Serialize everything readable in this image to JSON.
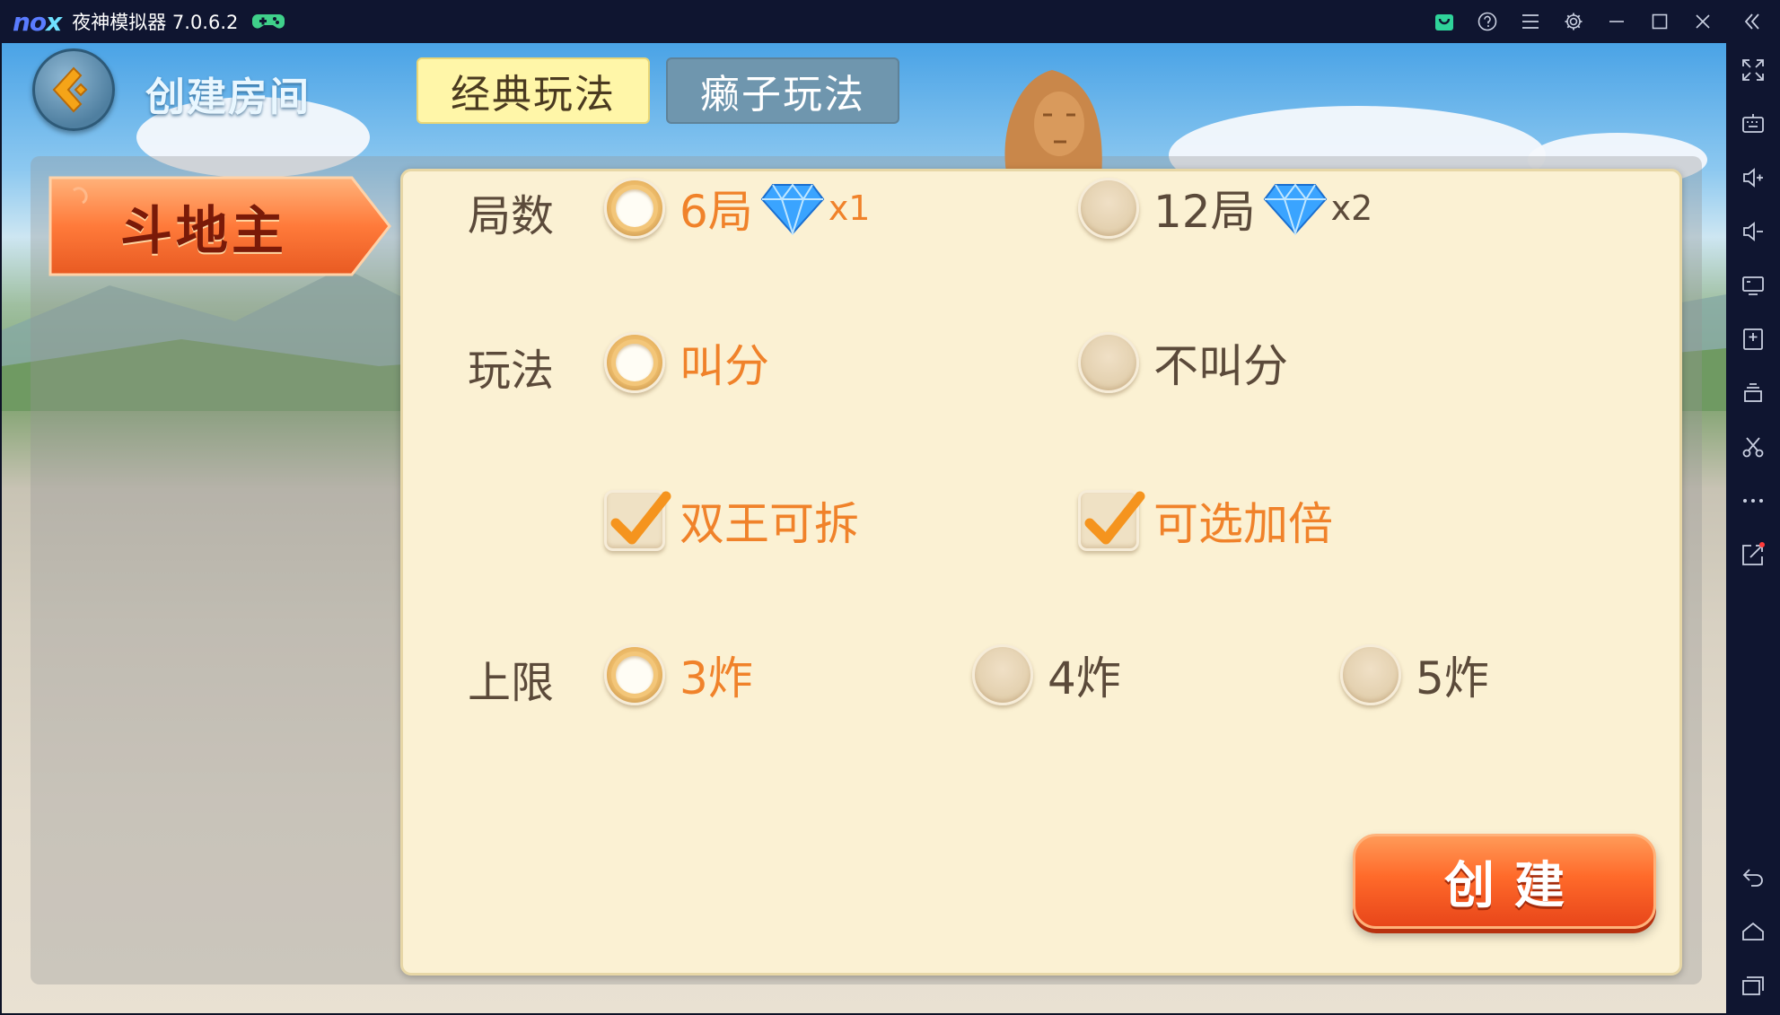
{
  "emulator": {
    "title": "夜神模拟器 7.0.6.2",
    "logo_text": "nox",
    "titlebar_icons": [
      "store-icon",
      "help-icon",
      "menu-icon",
      "settings-icon",
      "minimize-icon",
      "maximize-icon",
      "close-icon",
      "collapse-sidebar-icon"
    ],
    "sidebar_icons": [
      "fullscreen-icon",
      "keyboard-icon",
      "volume-up-icon",
      "volume-down-icon",
      "screen-icon",
      "apk-install-icon",
      "multi-instance-icon",
      "screenshot-icon",
      "more-icon",
      "share-icon",
      "back-icon",
      "home-icon",
      "recent-apps-icon"
    ]
  },
  "game": {
    "page_title": "创建房间",
    "tabs": [
      {
        "label": "经典玩法",
        "active": true
      },
      {
        "label": "癞子玩法",
        "active": false
      }
    ],
    "game_type": "斗地主",
    "rows": {
      "rounds": {
        "label": "局数",
        "options": [
          {
            "text": "6局",
            "selected": true,
            "cost": "x1"
          },
          {
            "text": "12局",
            "selected": false,
            "cost": "x2"
          }
        ]
      },
      "mode": {
        "label": "玩法",
        "options": [
          {
            "text": "叫分",
            "selected": true
          },
          {
            "text": "不叫分",
            "selected": false
          }
        ]
      },
      "extras": {
        "options": [
          {
            "text": "双王可拆",
            "checked": true
          },
          {
            "text": "可选加倍",
            "checked": true
          }
        ]
      },
      "limit": {
        "label": "上限",
        "options": [
          {
            "text": "3炸",
            "selected": true
          },
          {
            "text": "4炸",
            "selected": false
          },
          {
            "text": "5炸",
            "selected": false
          }
        ]
      }
    },
    "create_button": "创建"
  },
  "colors": {
    "accent_orange": "#f0822a",
    "panel_bg": "#fbf1d3",
    "titlebar_bg": "#0f1530"
  }
}
